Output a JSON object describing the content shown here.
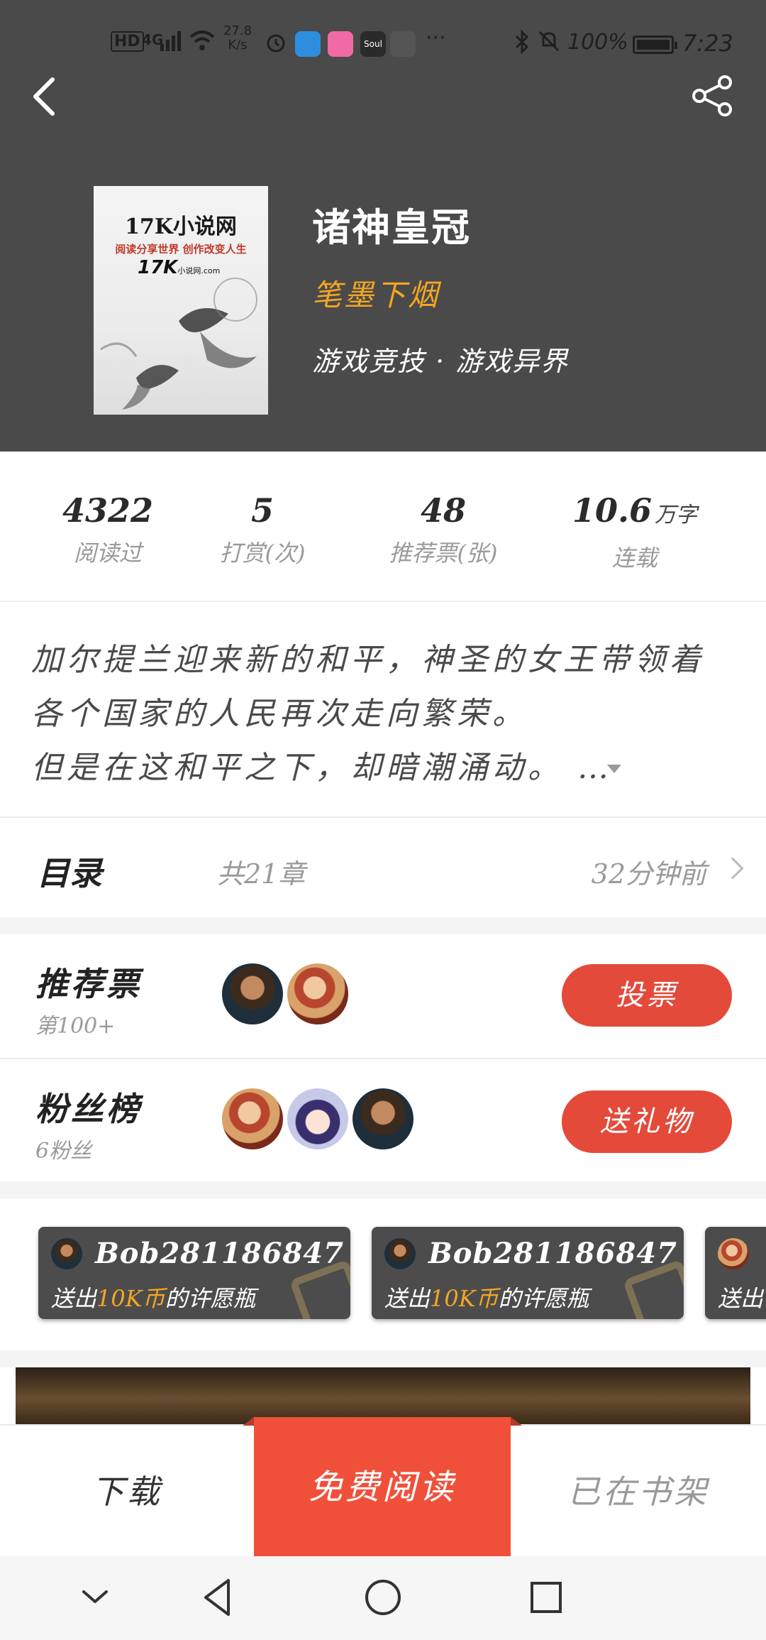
{
  "status_bar": {
    "hd": "HD",
    "network": "4G",
    "speed_value": "27.8",
    "speed_unit": "K/s",
    "more": "···",
    "battery_percent": "100%",
    "time": "7:23",
    "app_soul": "Soul"
  },
  "book": {
    "cover_title": "17K小说网",
    "cover_subtitle": "阅读分享世界 创作改变人生",
    "cover_logo": "17K",
    "cover_logo_small": "小说网",
    "cover_logo_domain": ".com",
    "title": "诸神皇冠",
    "author": "笔墨下烟",
    "category": "游戏竞技 · 游戏异界"
  },
  "stats": [
    {
      "value": "4322",
      "unit": "",
      "label": "阅读过"
    },
    {
      "value": "5",
      "unit": "",
      "label": "打赏(次)"
    },
    {
      "value": "48",
      "unit": "",
      "label": "推荐票(张)"
    },
    {
      "value": "10.6",
      "unit": "万字",
      "label": "连载"
    }
  ],
  "synopsis": {
    "line1": "加尔提兰迎来新的和平，神圣的女王带领着",
    "line2": "各个国家的人民再次走向繁荣。",
    "line3": "但是在这和平之下，却暗潮涌动。 …"
  },
  "toc": {
    "label": "目录",
    "count": "共21章",
    "updated": "32分钟前"
  },
  "recommend": {
    "title": "推荐票",
    "rank": "第100+",
    "button": "投票"
  },
  "fans": {
    "title": "粉丝榜",
    "count": "6粉丝",
    "button": "送礼物"
  },
  "gifts": [
    {
      "user": "Bob281186847",
      "prefix": "送出",
      "amount": "10K币",
      "suffix": "的许愿瓶"
    },
    {
      "user": "Bob281186847",
      "prefix": "送出",
      "amount": "10K币",
      "suffix": "的许愿瓶"
    },
    {
      "user": "",
      "prefix": "送出",
      "amount": "",
      "suffix": ""
    }
  ],
  "actions": {
    "download": "下载",
    "read": "免费阅读",
    "shelf": "已在书架"
  },
  "colors": {
    "header_bg": "#4a4a4a",
    "accent_orange": "#f5a623",
    "button_red": "#e34a3a",
    "read_red": "#f0503a"
  }
}
